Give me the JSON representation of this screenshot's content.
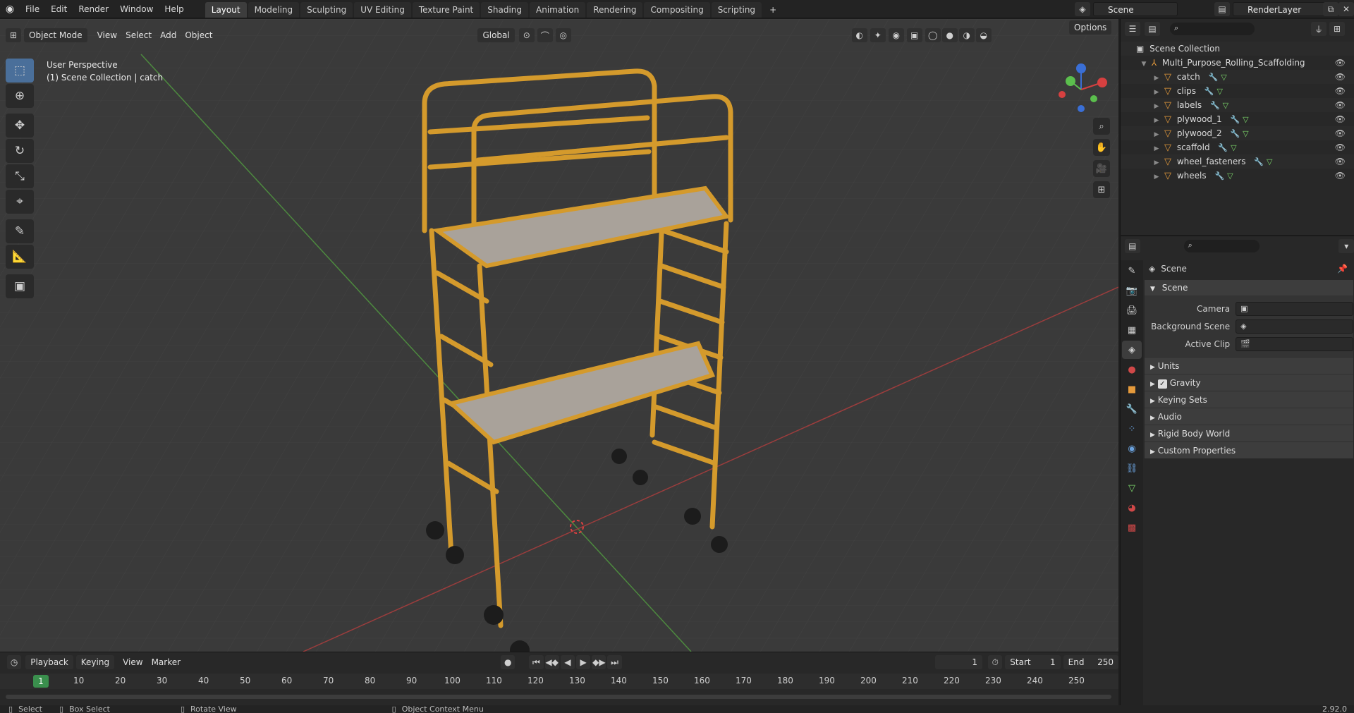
{
  "app": {
    "menus": [
      "File",
      "Edit",
      "Render",
      "Window",
      "Help"
    ],
    "workspaces": [
      "Layout",
      "Modeling",
      "Sculpting",
      "UV Editing",
      "Texture Paint",
      "Shading",
      "Animation",
      "Rendering",
      "Compositing",
      "Scripting"
    ],
    "add_workspace": "+",
    "scene_name": "Scene",
    "render_layer": "RenderLayer"
  },
  "viewport": {
    "mode": "Object Mode",
    "menus": [
      "View",
      "Select",
      "Add",
      "Object"
    ],
    "transform_orientation": "Global",
    "options_label": "Options",
    "overlay_title": "User Perspective",
    "overlay_subtitle": "(1) Scene Collection | catch",
    "gizmo": {
      "x": "X",
      "y": "Y",
      "z": "Z"
    }
  },
  "outliner": {
    "root": "Scene Collection",
    "collection": "Multi_Purpose_Rolling_Scaffolding",
    "objects": [
      "catch",
      "clips",
      "labels",
      "plywood_1",
      "plywood_2",
      "scaffold",
      "wheel_fasteners",
      "wheels"
    ]
  },
  "properties": {
    "context": "Scene",
    "panel_title": "Scene",
    "fields": [
      {
        "label": "Camera",
        "value": ""
      },
      {
        "label": "Background Scene",
        "value": ""
      },
      {
        "label": "Active Clip",
        "value": ""
      }
    ],
    "subpanels": [
      "Units",
      "Gravity",
      "Keying Sets",
      "Audio",
      "Rigid Body World",
      "Custom Properties"
    ]
  },
  "timeline": {
    "menus": [
      "Playback",
      "Keying",
      "View",
      "Marker"
    ],
    "current_frame": "1",
    "start_label": "Start",
    "start": "1",
    "end_label": "End",
    "end": "250",
    "ticks": [
      "1",
      "10",
      "20",
      "30",
      "40",
      "50",
      "60",
      "70",
      "80",
      "90",
      "100",
      "110",
      "120",
      "130",
      "140",
      "150",
      "160",
      "170",
      "180",
      "190",
      "200",
      "210",
      "220",
      "230",
      "240",
      "250"
    ]
  },
  "status": {
    "select": "Select",
    "box_select": "Box Select",
    "rotate": "Rotate View",
    "context_menu": "Object Context Menu",
    "version": "2.92.0"
  }
}
